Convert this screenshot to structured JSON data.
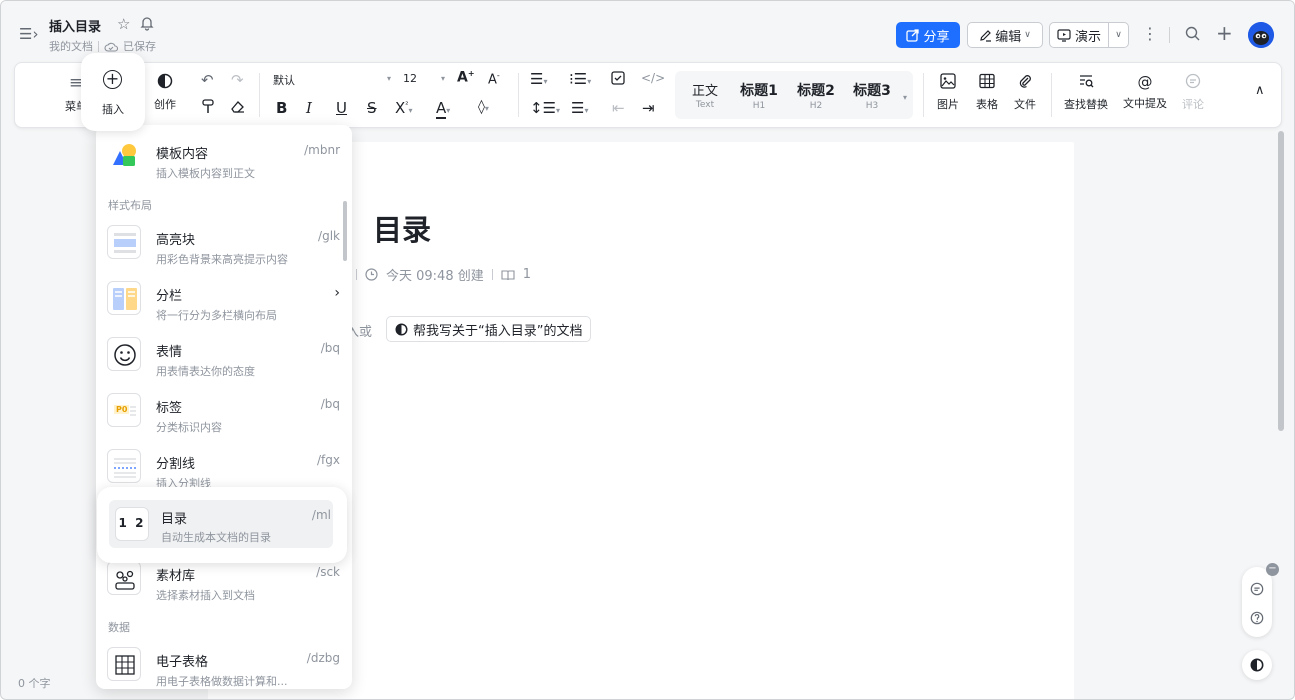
{
  "header": {
    "title": "插入目录",
    "breadcrumb": "我的文档",
    "save_status": "已保存",
    "share_label": "分享",
    "edit_label": "编辑",
    "present_label": "演示"
  },
  "toolbar": {
    "menu_label": "菜单",
    "insert_label": "插入",
    "create_label": "创作",
    "font_family": "默认",
    "font_size": "12",
    "styles": [
      {
        "label": "正文",
        "sub": "Text"
      },
      {
        "label": "标题1",
        "sub": "H1"
      },
      {
        "label": "标题2",
        "sub": "H2"
      },
      {
        "label": "标题3",
        "sub": "H3"
      }
    ],
    "image_label": "图片",
    "table_label": "表格",
    "file_label": "文件",
    "find_replace_label": "查找替换",
    "mention_label": "文中提及",
    "comment_label": "评论"
  },
  "document": {
    "heading": "目录",
    "meta_created": "今天 09:48 创建",
    "meta_views": "1",
    "placeholder_or": "入或",
    "ai_prompt": "帮我写关于“插入目录”的文档"
  },
  "status": {
    "word_count": "0 个字"
  },
  "insert_menu": {
    "items": [
      {
        "title": "模板内容",
        "desc": "插入模板内容到正文",
        "shortcut": "/mbnr",
        "icon": "template-icon"
      },
      {
        "section": "样式布局"
      },
      {
        "title": "高亮块",
        "desc": "用彩色背景来高亮提示内容",
        "shortcut": "/glk",
        "icon": "highlight-block-icon"
      },
      {
        "title": "分栏",
        "desc": "将一行分为多栏横向布局",
        "shortcut": "",
        "icon": "columns-icon"
      },
      {
        "title": "表情",
        "desc": "用表情表达你的态度",
        "shortcut": "/bq",
        "icon": "emoji-icon"
      },
      {
        "title": "标签",
        "desc": "分类标识内容",
        "shortcut": "/bq",
        "icon": "tag-icon"
      },
      {
        "title": "分割线",
        "desc": "插入分割线",
        "shortcut": "/fgx",
        "icon": "divider-icon"
      },
      {
        "title": "目录",
        "desc": "自动生成本文档的目录",
        "shortcut": "/ml",
        "icon": "toc-icon",
        "toc_glyph": "1 2"
      },
      {
        "title": "素材库",
        "desc": "选择素材插入到文档",
        "shortcut": "/sck",
        "icon": "material-library-icon"
      },
      {
        "section": "数据"
      },
      {
        "title": "电子表格",
        "desc": "用电子表格做数据计算和...",
        "shortcut": "/dzbg",
        "icon": "spreadsheet-icon"
      }
    ],
    "tag_glyph": "P0"
  }
}
